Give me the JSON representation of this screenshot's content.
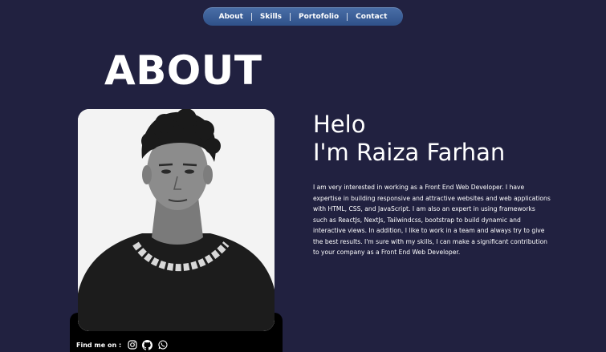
{
  "nav": {
    "items": [
      {
        "label": "About"
      },
      {
        "label": "Skills"
      },
      {
        "label": "Portofolio"
      },
      {
        "label": "Contact"
      }
    ]
  },
  "about": {
    "title": "ABOUT",
    "greeting_line1": "Helo",
    "greeting_line2": "I'm Raiza Farhan",
    "bio": "I am very interested in working as a Front End Web Developer. I have expertise in building responsive and attractive websites and web applications with HTML, CSS, and JavaScript. I am also an expert in using frameworks such as ReactJs, NextJs, Tailwindcss, bootstrap to build dynamic and interactive views. In addition, I like to work in a team and always try to give the best results. I'm sure with my skills, I can make a significant contribution to your company as a Front End Web Developer."
  },
  "findme": {
    "label": "Find me on :",
    "icons": [
      "instagram-icon",
      "github-icon",
      "whatsapp-icon"
    ]
  },
  "colors": {
    "background": "#212140",
    "nav_pill": "#3a5c96",
    "text": "#ffffff",
    "findme_bar": "#000000"
  }
}
